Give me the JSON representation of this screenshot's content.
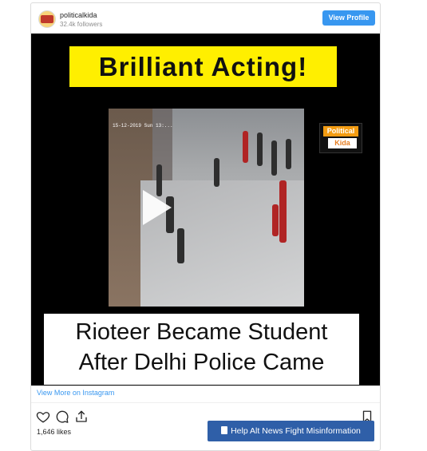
{
  "post": {
    "username": "politicalkida",
    "followers": "32.4k followers",
    "view_profile_label": "View Profile",
    "view_more_label": "View More on Instagram",
    "likes": "1,646 likes"
  },
  "media": {
    "top_banner": "Brilliant Acting!",
    "bottom_line1": "Rioteer Became Student",
    "bottom_line2": "After Delhi Police Came",
    "watermark_top": "Political",
    "watermark_bottom": "Kida",
    "cctv_timestamp": "15-12-2019 Sun 13:..."
  },
  "help_button": {
    "label": "Help Alt News Fight Misinformation"
  },
  "colors": {
    "link_blue": "#3897f0",
    "banner_yellow": "#ffef00",
    "help_blue": "#2f5fa8"
  },
  "icons": [
    "heart-icon",
    "comment-icon",
    "share-icon",
    "bookmark-icon",
    "play-icon",
    "document-icon"
  ]
}
